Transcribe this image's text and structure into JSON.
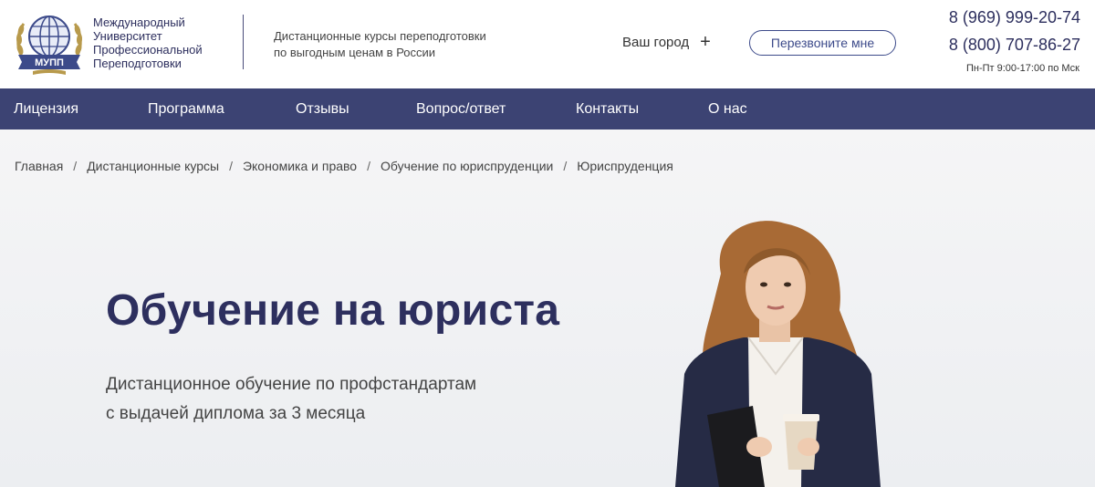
{
  "header": {
    "logo_text": "МУПП",
    "university_lines": [
      "Международный",
      "Университет",
      "Профессиональной",
      "Переподготовки"
    ],
    "tagline_lines": [
      "Дистанционные курсы переподготовки",
      "по выгодным ценам в России"
    ],
    "city_label": "Ваш город",
    "callback_label": "Перезвоните мне",
    "phone_1": "8 (969) 999-20-74",
    "phone_2": "8 (800) 707-86-27",
    "hours": "Пн-Пт 9:00-17:00 по Мск"
  },
  "nav": {
    "items": [
      "Лицензия",
      "Программа",
      "Отзывы",
      "Вопрос/ответ",
      "Контакты",
      "О нас"
    ]
  },
  "breadcrumb": {
    "items": [
      "Главная",
      "Дистанционные курсы",
      "Экономика и право",
      "Обучение по юриспруденции",
      "Юриспруденция"
    ],
    "separator": "/"
  },
  "hero": {
    "title": "Обучение на юриста",
    "subtitle_lines": [
      "Дистанционное обучение по профстандартам",
      "с выдачей диплома за 3 месяца"
    ]
  },
  "colors": {
    "brand_dark": "#2d2f5e",
    "nav_bg": "#3c4373",
    "accent": "#3c4a8a"
  }
}
